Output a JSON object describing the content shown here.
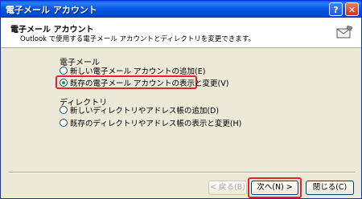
{
  "window": {
    "title": "電子メール アカウント"
  },
  "titlebar": {
    "help_label": "?",
    "close_label": "✕"
  },
  "header": {
    "title": "電子メール アカウント",
    "subtitle": "Outlook で使用する電子メール アカウントとディレクトリを変更できます。",
    "icon": "envelope-settings-icon"
  },
  "email_group": {
    "label": "電子メール",
    "options": [
      {
        "label": "新しい電子メール アカウントの追加(E)",
        "selected": false
      },
      {
        "label": "既存の電子メール アカウントの表示と変更(V)",
        "selected": true
      }
    ]
  },
  "directory_group": {
    "label": "ディレクトリ",
    "options": [
      {
        "label": "新しいディレクトリやアドレス帳の追加(D)",
        "selected": false
      },
      {
        "label": "既存のディレクトリやアドレス帳の表示と変更(H)",
        "selected": false
      }
    ]
  },
  "buttons": {
    "back": "< 戻る(B)",
    "next": "次へ(N) >",
    "close": "閉じる(C)"
  },
  "colors": {
    "highlight": "#e8202c",
    "titlebar": "#0a5ee8"
  }
}
